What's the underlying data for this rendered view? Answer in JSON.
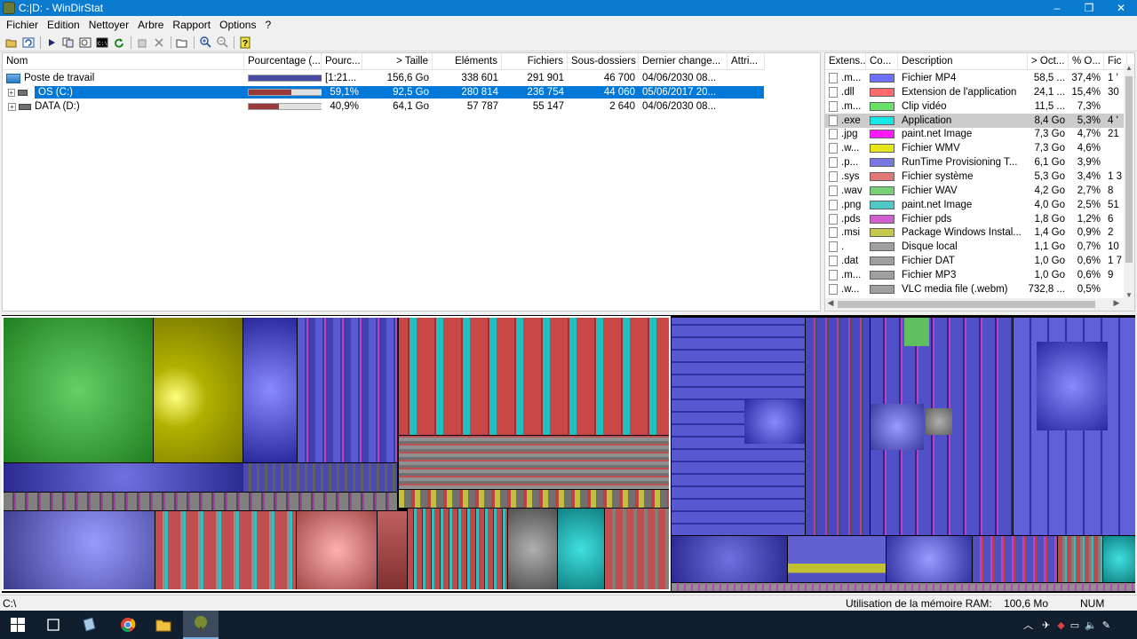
{
  "window": {
    "title": "C:|D: - WinDirStat",
    "minimize": "–",
    "maximize": "❐",
    "close": "✕"
  },
  "menu": [
    "Fichier",
    "Edition",
    "Nettoyer",
    "Arbre",
    "Rapport",
    "Options",
    "?"
  ],
  "toolbar_icons": [
    "open-icon",
    "refresh-all-icon",
    "play-icon",
    "copy-path-icon",
    "explorer-icon",
    "cmd-icon",
    "refresh-icon",
    "recycle-icon",
    "delete-icon",
    "new-folder-icon",
    "zoom-in-icon",
    "zoom-out-icon",
    "help-icon"
  ],
  "tree": {
    "columns": [
      "Nom",
      "Pourcentage (...",
      "Pourc...",
      "> Taille",
      "Eléments",
      "Fichiers",
      "Sous-dossiers",
      "Dernier change...",
      "Attri..."
    ],
    "rows": [
      {
        "name": "Poste de travail",
        "percent_text": "[1:21...",
        "fill": 1.0,
        "fill_color": "#4a4aa0",
        "size": "156,6 Go",
        "items": "338 601",
        "files": "291 901",
        "subdirs": "46 700",
        "changed": "04/06/2030  08...",
        "attr": "",
        "selected": false
      },
      {
        "name": "OS (C:)",
        "percent_text": "59,1%",
        "fill": 0.591,
        "fill_color": "#9a3a3a",
        "size": "92,5 Go",
        "items": "280 814",
        "files": "236 754",
        "subdirs": "44 060",
        "changed": "05/06/2017  20...",
        "attr": "",
        "selected": true
      },
      {
        "name": "DATA (D:)",
        "percent_text": "40,9%",
        "fill": 0.409,
        "fill_color": "#9a3a3a",
        "size": "64,1 Go",
        "items": "57 787",
        "files": "55 147",
        "subdirs": "2 640",
        "changed": "04/06/2030  08...",
        "attr": "",
        "selected": false
      }
    ]
  },
  "extensions": {
    "columns": [
      "Extens...",
      "Co...",
      "Description",
      "> Oct...",
      "% O...",
      "Fic"
    ],
    "rows": [
      {
        "ext": ".m...",
        "color": "#7070ff",
        "desc": "Fichier MP4",
        "bytes": "58,5 ...",
        "pct": "37,4%",
        "files": "1 '"
      },
      {
        "ext": ".dll",
        "color": "#ff6a6a",
        "desc": "Extension de l'application",
        "bytes": "24,1 ...",
        "pct": "15,4%",
        "files": "30"
      },
      {
        "ext": ".m...",
        "color": "#66e066",
        "desc": "Clip vidéo",
        "bytes": "11,5 ...",
        "pct": "7,3%",
        "files": ""
      },
      {
        "ext": ".exe",
        "color": "#19e6e6",
        "desc": "Application",
        "bytes": "8,4 Go",
        "pct": "5,3%",
        "files": "4 '"
      },
      {
        "ext": ".jpg",
        "color": "#ff19ff",
        "desc": "paint.net Image",
        "bytes": "7,3 Go",
        "pct": "4,7%",
        "files": "21"
      },
      {
        "ext": ".w...",
        "color": "#e6e619",
        "desc": "Fichier WMV",
        "bytes": "7,3 Go",
        "pct": "4,6%",
        "files": ""
      },
      {
        "ext": ".p...",
        "color": "#7878e0",
        "desc": "RunTime Provisioning T...",
        "bytes": "6,1 Go",
        "pct": "3,9%",
        "files": ""
      },
      {
        "ext": ".sys",
        "color": "#e07878",
        "desc": "Fichier système",
        "bytes": "5,3 Go",
        "pct": "3,4%",
        "files": "1 3"
      },
      {
        "ext": ".wav",
        "color": "#78d078",
        "desc": "Fichier WAV",
        "bytes": "4,2 Go",
        "pct": "2,7%",
        "files": "8"
      },
      {
        "ext": ".png",
        "color": "#50c8c8",
        "desc": "paint.net Image",
        "bytes": "4,0 Go",
        "pct": "2,5%",
        "files": "51"
      },
      {
        "ext": ".pds",
        "color": "#d060d0",
        "desc": "Fichier pds",
        "bytes": "1,8 Go",
        "pct": "1,2%",
        "files": "6"
      },
      {
        "ext": ".msi",
        "color": "#c8c850",
        "desc": "Package Windows Instal...",
        "bytes": "1,4 Go",
        "pct": "0,9%",
        "files": "2"
      },
      {
        "ext": ".",
        "color": "#a0a0a0",
        "desc": "Disque local",
        "bytes": "1,1 Go",
        "pct": "0,7%",
        "files": "10"
      },
      {
        "ext": ".dat",
        "color": "#a0a0a0",
        "desc": "Fichier DAT",
        "bytes": "1,0 Go",
        "pct": "0,6%",
        "files": "1 7"
      },
      {
        "ext": ".m...",
        "color": "#a0a0a0",
        "desc": "Fichier MP3",
        "bytes": "1,0 Go",
        "pct": "0,6%",
        "files": "9"
      },
      {
        "ext": ".w...",
        "color": "#a0a0a0",
        "desc": "VLC media file (.webm)",
        "bytes": "732,8 ...",
        "pct": "0,5%",
        "files": ""
      }
    ],
    "highlighted_index": 3
  },
  "status": {
    "path": "C:\\",
    "ram_label": "Utilisation de la mémoire RAM:",
    "ram_value": "100,6 Mo",
    "num": "NUM"
  },
  "colors": {
    "titlebar": "#0b7bd0",
    "selection": "#0078d7",
    "taskbar": "#101e2e"
  }
}
